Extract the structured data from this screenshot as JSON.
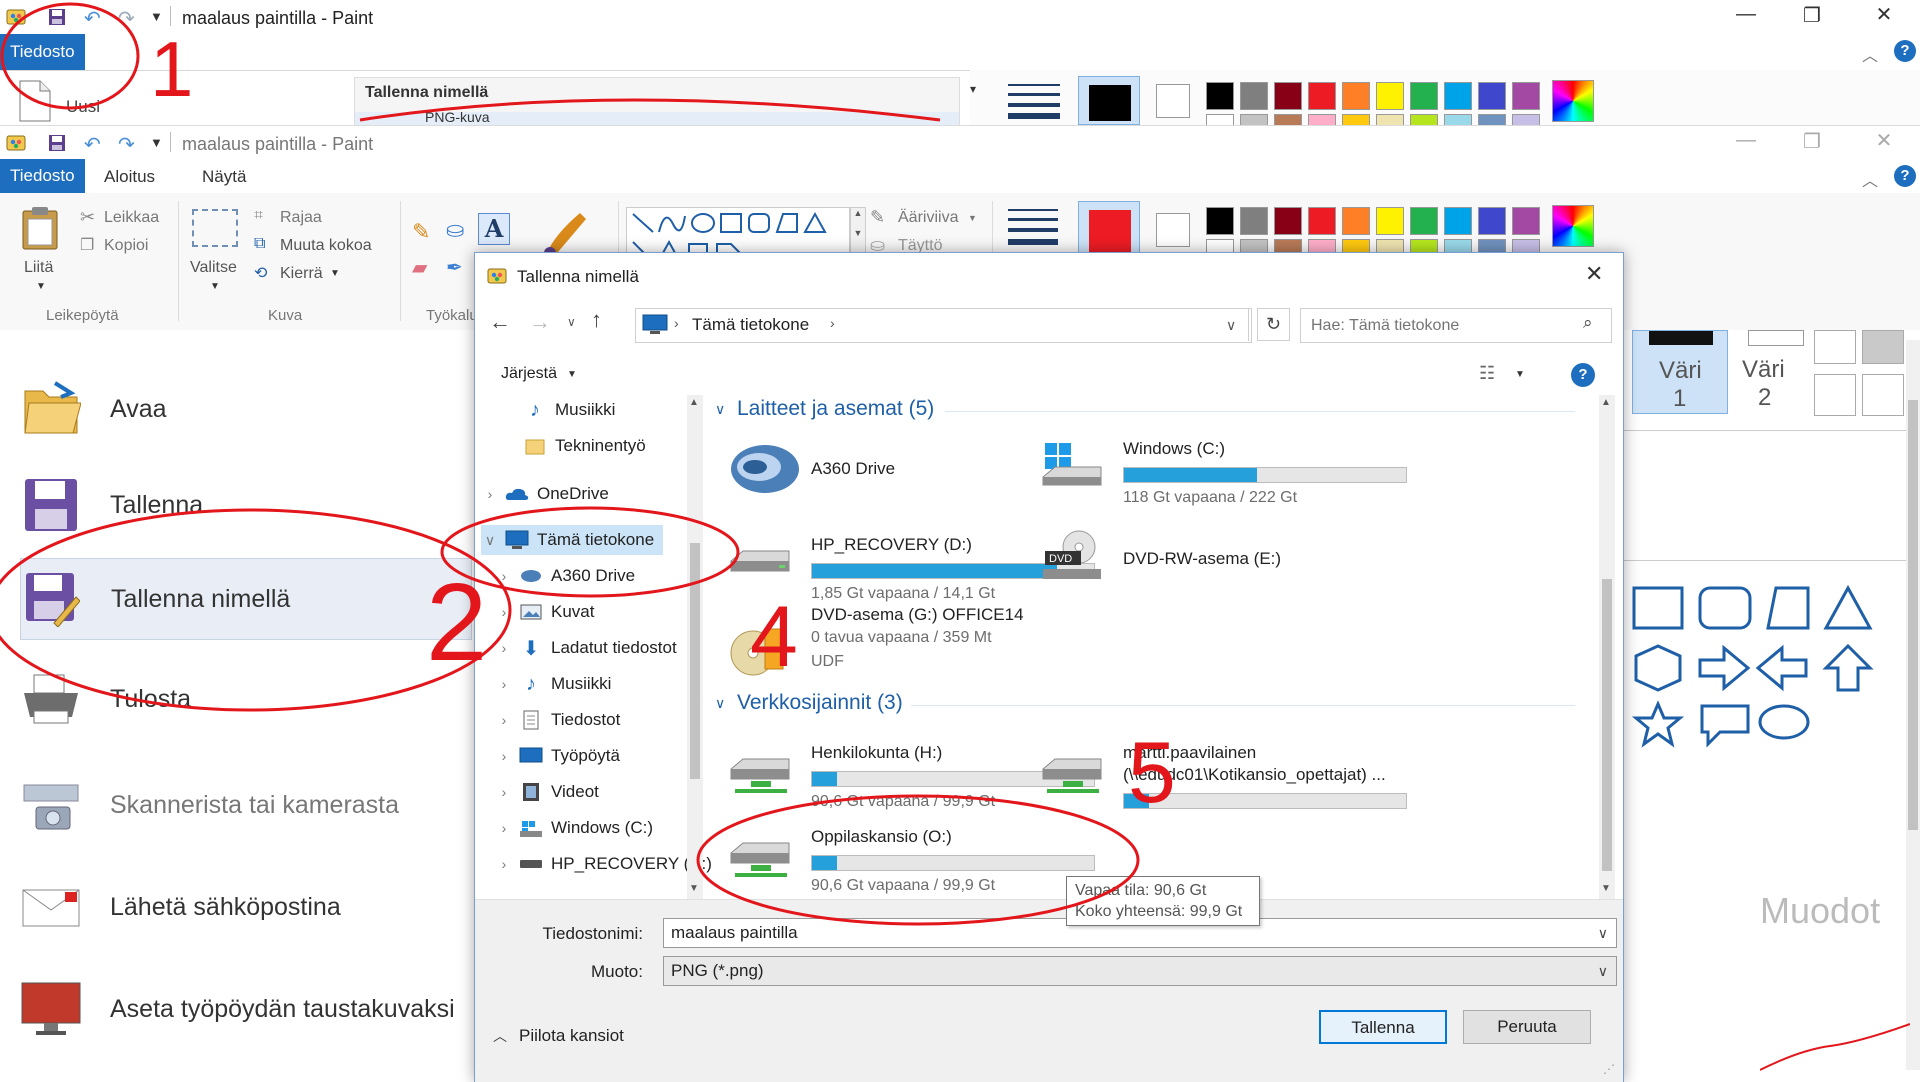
{
  "back_window": {
    "title": "maalaus paintilla - Paint",
    "file_tab": "Tiedosto",
    "new_item": "Uusi",
    "save_as_header": "Tallenna nimellä",
    "partial_item": "PNG-kuva"
  },
  "front_window": {
    "title": "maalaus paintilla - Paint",
    "tabs": [
      "Tiedosto",
      "Aloitus",
      "Näytä"
    ],
    "ribbon": {
      "paste": "Liitä",
      "cut": "Leikkaa",
      "copy": "Kopioi",
      "clipboard_group": "Leikepöytä",
      "select": "Valitse",
      "crop": "Rajaa",
      "resize": "Muuta kokoa",
      "rotate": "Kierrä",
      "image_group": "Kuva",
      "tools_group": "Työkalut",
      "text_tool": "A",
      "outline": "Ääriviiva",
      "fill": "Täyttö",
      "color1": "Väri",
      "color1_num": "1",
      "color2": "Väri",
      "color2_num": "2"
    },
    "shapes_label": "Muodot",
    "palette": [
      "#000000",
      "#7f7f7f",
      "#880015",
      "#ed1c24",
      "#ff7f27",
      "#fff200",
      "#22b14c",
      "#00a2e8",
      "#3f48cc",
      "#a349a4"
    ],
    "palette_row2": [
      "#ffffff",
      "#c3c3c3",
      "#b97a57",
      "#ffaec9",
      "#ffc90e",
      "#efe4b0",
      "#b5e61d",
      "#99d9ea",
      "#7092be",
      "#c8bfe7"
    ],
    "primary_color": "#ed1c24"
  },
  "file_menu": {
    "items": [
      "Avaa",
      "Tallenna",
      "Tallenna nimellä",
      "Tulosta",
      "Skannerista tai kamerasta",
      "Lähetä sähköpostina",
      "Aseta työpöydän taustakuvaksi"
    ]
  },
  "dialog": {
    "title": "Tallenna nimellä",
    "address": "Tämä tietokone",
    "search_placeholder": "Hae: Tämä tietokone",
    "organize": "Järjestä",
    "nav_tree": [
      "Musiikki",
      "Tekninentyö",
      "OneDrive",
      "Tämä tietokone",
      "A360 Drive",
      "Kuvat",
      "Ladatut tiedostot",
      "Musiikki",
      "Tiedostot",
      "Työpöytä",
      "Videot",
      "Windows (C:)",
      "HP_RECOVERY (D:)"
    ],
    "group_devices": "Laitteet ja asemat (5)",
    "group_network": "Verkkosijainnit (3)",
    "drives": [
      {
        "name": "A360 Drive",
        "sub": "",
        "fill": 0
      },
      {
        "name": "Windows (C:)",
        "sub": "118 Gt vapaana / 222 Gt",
        "fill": 0.47
      },
      {
        "name": "HP_RECOVERY (D:)",
        "sub": "1,85 Gt vapaana / 14,1 Gt",
        "fill": 0.87
      },
      {
        "name": "DVD-RW-asema (E:)",
        "sub": "",
        "fill": 0
      },
      {
        "name": "DVD-asema (G:) OFFICE14",
        "sub": "0 tavua vapaana / 359 Mt",
        "sub2": "UDF",
        "fill": 0
      }
    ],
    "network": [
      {
        "name": "Henkilokunta (H:)",
        "sub": "90,6 Gt vapaana / 99,9 Gt",
        "fill": 0.09
      },
      {
        "name": "martti.paavilainen",
        "name2": "(\\\\edudc01\\Kotikansio_opettajat) ...",
        "sub": "",
        "fill": 0.09
      },
      {
        "name": "Oppilaskansio (O:)",
        "sub": "90,6 Gt vapaana / 99,9 Gt",
        "fill": 0.09
      }
    ],
    "tooltip_line1": "Vapaa tila: 90,6 Gt",
    "tooltip_line2": "Koko yhteensä: 99,9 Gt",
    "filename_label": "Tiedostonimi:",
    "filename_value": "maalaus paintilla",
    "format_label": "Muoto:",
    "format_value": "PNG (*.png)",
    "hide_folders": "Piilota kansiot",
    "save_button": "Tallenna",
    "cancel_button": "Peruuta"
  },
  "annotations": [
    "1",
    "2",
    "4",
    "5"
  ],
  "annotation_color": "#e3161b"
}
